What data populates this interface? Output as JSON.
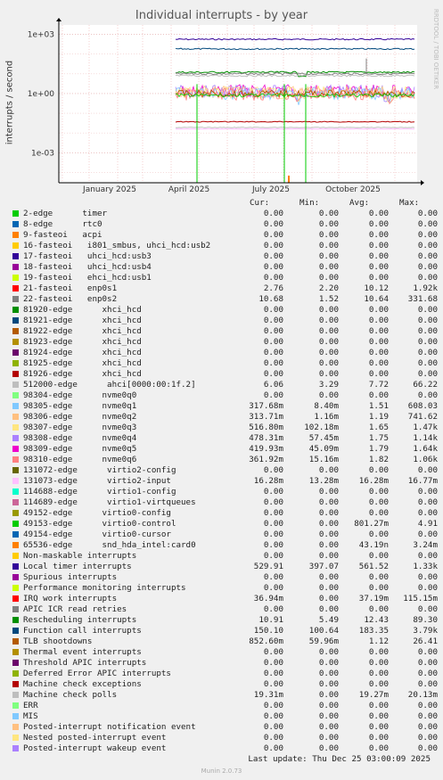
{
  "title": "Individual interrupts - by year",
  "watermark": "RRDTOOL / TOBI OETIKER",
  "chart_data": {
    "type": "line",
    "title": "Individual interrupts - by year",
    "ylabel": "interrupts / second",
    "yscale": "log",
    "ylim": [
      3e-05,
      3000
    ],
    "yticks": [
      {
        "label": "1e+03",
        "value": 1000
      },
      {
        "label": "1e+00",
        "value": 1
      },
      {
        "label": "1e-03",
        "value": 0.001
      }
    ],
    "xticks": [
      "January 2025",
      "April 2025",
      "July 2025",
      "October 2025"
    ],
    "series_summary": [
      {
        "name": "Local timer interrupts",
        "avg": 561.52
      },
      {
        "name": "Function call interrupts",
        "avg": 183.35
      },
      {
        "name": "21-fasteoi enp0s1",
        "avg": 10.12
      },
      {
        "name": "22-fasteoi enp0s2",
        "avg": 10.64
      },
      {
        "name": "Rescheduling interrupts",
        "avg": 12.43
      },
      {
        "name": "512000-edge ahci[0000:00:1f.2]",
        "avg": 7.72
      }
    ]
  },
  "columns": {
    "cur": "Cur:",
    "min": "Min:",
    "avg": "Avg:",
    "max": "Max:"
  },
  "rows": [
    {
      "label": "2-edge      timer",
      "color": "#00cc00",
      "cur": "0.00",
      "min": "0.00",
      "avg": "0.00",
      "max": "0.00"
    },
    {
      "label": "8-edge      rtc0",
      "color": "#0066b3",
      "cur": "0.00",
      "min": "0.00",
      "avg": "0.00",
      "max": "0.00"
    },
    {
      "label": "9-fasteoi   acpi",
      "color": "#ff8000",
      "cur": "0.00",
      "min": "0.00",
      "avg": "0.00",
      "max": "0.00"
    },
    {
      "label": "16-fasteoi   i801_smbus, uhci_hcd:usb2",
      "color": "#ffcc00",
      "cur": "0.00",
      "min": "0.00",
      "avg": "0.00",
      "max": "0.00"
    },
    {
      "label": "17-fasteoi   uhci_hcd:usb3",
      "color": "#330099",
      "cur": "0.00",
      "min": "0.00",
      "avg": "0.00",
      "max": "0.00"
    },
    {
      "label": "18-fasteoi   uhci_hcd:usb4",
      "color": "#990099",
      "cur": "0.00",
      "min": "0.00",
      "avg": "0.00",
      "max": "0.00"
    },
    {
      "label": "19-fasteoi   ehci_hcd:usb1",
      "color": "#ccff00",
      "cur": "0.00",
      "min": "0.00",
      "avg": "0.00",
      "max": "0.00"
    },
    {
      "label": "21-fasteoi   enp0s1",
      "color": "#ff0000",
      "cur": "2.76",
      "min": "2.20",
      "avg": "10.12",
      "max": "1.92k"
    },
    {
      "label": "22-fasteoi   enp0s2",
      "color": "#808080",
      "cur": "10.68",
      "min": "1.52",
      "avg": "10.64",
      "max": "331.68"
    },
    {
      "label": "81920-edge      xhci_hcd",
      "color": "#008f00",
      "cur": "0.00",
      "min": "0.00",
      "avg": "0.00",
      "max": "0.00"
    },
    {
      "label": "81921-edge      xhci_hcd",
      "color": "#00487d",
      "cur": "0.00",
      "min": "0.00",
      "avg": "0.00",
      "max": "0.00"
    },
    {
      "label": "81922-edge      xhci_hcd",
      "color": "#b35a00",
      "cur": "0.00",
      "min": "0.00",
      "avg": "0.00",
      "max": "0.00"
    },
    {
      "label": "81923-edge      xhci_hcd",
      "color": "#b38f00",
      "cur": "0.00",
      "min": "0.00",
      "avg": "0.00",
      "max": "0.00"
    },
    {
      "label": "81924-edge      xhci_hcd",
      "color": "#6b006b",
      "cur": "0.00",
      "min": "0.00",
      "avg": "0.00",
      "max": "0.00"
    },
    {
      "label": "81925-edge      xhci_hcd",
      "color": "#8fb300",
      "cur": "0.00",
      "min": "0.00",
      "avg": "0.00",
      "max": "0.00"
    },
    {
      "label": "81926-edge      xhci_hcd",
      "color": "#b30000",
      "cur": "0.00",
      "min": "0.00",
      "avg": "0.00",
      "max": "0.00"
    },
    {
      "label": "512000-edge      ahci[0000:00:1f.2]",
      "color": "#bebebe",
      "cur": "6.06",
      "min": "3.29",
      "avg": "7.72",
      "max": "66.22"
    },
    {
      "label": "98304-edge      nvme0q0",
      "color": "#80ff80",
      "cur": "0.00",
      "min": "0.00",
      "avg": "0.00",
      "max": "0.00"
    },
    {
      "label": "98305-edge      nvme0q1",
      "color": "#80c9ff",
      "cur": "317.68m",
      "min": "8.40m",
      "avg": "1.51",
      "max": "608.03"
    },
    {
      "label": "98306-edge      nvme0q2",
      "color": "#ffc080",
      "cur": "313.71m",
      "min": "1.16m",
      "avg": "1.19",
      "max": "741.62"
    },
    {
      "label": "98307-edge      nvme0q3",
      "color": "#ffe680",
      "cur": "516.80m",
      "min": "102.18m",
      "avg": "1.65",
      "max": "1.47k"
    },
    {
      "label": "98308-edge      nvme0q4",
      "color": "#aa80ff",
      "cur": "478.31m",
      "min": "57.45m",
      "avg": "1.75",
      "max": "1.14k"
    },
    {
      "label": "98309-edge      nvme0q5",
      "color": "#ee00cc",
      "cur": "419.93m",
      "min": "45.09m",
      "avg": "1.79",
      "max": "1.64k"
    },
    {
      "label": "98310-edge      nvme0q6",
      "color": "#ff8080",
      "cur": "361.92m",
      "min": "15.16m",
      "avg": "1.82",
      "max": "1.06k"
    },
    {
      "label": "131072-edge      virtio2-config",
      "color": "#666600",
      "cur": "0.00",
      "min": "0.00",
      "avg": "0.00",
      "max": "0.00"
    },
    {
      "label": "131073-edge      virtio2-input",
      "color": "#ffbfff",
      "cur": "16.28m",
      "min": "13.28m",
      "avg": "16.28m",
      "max": "16.77m"
    },
    {
      "label": "114688-edge      virtio1-config",
      "color": "#00ffcc",
      "cur": "0.00",
      "min": "0.00",
      "avg": "0.00",
      "max": "0.00"
    },
    {
      "label": "114689-edge      virtio1-virtqueues",
      "color": "#cc6699",
      "cur": "0.00",
      "min": "0.00",
      "avg": "0.00",
      "max": "0.00"
    },
    {
      "label": "49152-edge      virtio0-config",
      "color": "#999900",
      "cur": "0.00",
      "min": "0.00",
      "avg": "0.00",
      "max": "0.00"
    },
    {
      "label": "49153-edge      virtio0-control",
      "color": "#00cc00",
      "cur": "0.00",
      "min": "0.00",
      "avg": "801.27m",
      "max": "4.91"
    },
    {
      "label": "49154-edge      virtio0-cursor",
      "color": "#0066b3",
      "cur": "0.00",
      "min": "0.00",
      "avg": "0.00",
      "max": "0.00"
    },
    {
      "label": "65536-edge      snd_hda_intel:card0",
      "color": "#ff8000",
      "cur": "0.00",
      "min": "0.00",
      "avg": "43.19n",
      "max": "3.24m"
    },
    {
      "label": "Non-maskable interrupts",
      "color": "#ffcc00",
      "cur": "0.00",
      "min": "0.00",
      "avg": "0.00",
      "max": "0.00"
    },
    {
      "label": "Local timer interrupts",
      "color": "#330099",
      "cur": "529.91",
      "min": "397.07",
      "avg": "561.52",
      "max": "1.33k"
    },
    {
      "label": "Spurious interrupts",
      "color": "#990099",
      "cur": "0.00",
      "min": "0.00",
      "avg": "0.00",
      "max": "0.00"
    },
    {
      "label": "Performance monitoring interrupts",
      "color": "#ccff00",
      "cur": "0.00",
      "min": "0.00",
      "avg": "0.00",
      "max": "0.00"
    },
    {
      "label": "IRQ work interrupts",
      "color": "#ff0000",
      "cur": "36.94m",
      "min": "0.00",
      "avg": "37.19m",
      "max": "115.15m"
    },
    {
      "label": "APIC ICR read retries",
      "color": "#808080",
      "cur": "0.00",
      "min": "0.00",
      "avg": "0.00",
      "max": "0.00"
    },
    {
      "label": "Rescheduling interrupts",
      "color": "#008f00",
      "cur": "10.91",
      "min": "5.49",
      "avg": "12.43",
      "max": "89.30"
    },
    {
      "label": "Function call interrupts",
      "color": "#00487d",
      "cur": "150.10",
      "min": "100.64",
      "avg": "183.35",
      "max": "3.79k"
    },
    {
      "label": "TLB shootdowns",
      "color": "#b35a00",
      "cur": "852.60m",
      "min": "59.96m",
      "avg": "1.12",
      "max": "26.41"
    },
    {
      "label": "Thermal event interrupts",
      "color": "#b38f00",
      "cur": "0.00",
      "min": "0.00",
      "avg": "0.00",
      "max": "0.00"
    },
    {
      "label": "Threshold APIC interrupts",
      "color": "#6b006b",
      "cur": "0.00",
      "min": "0.00",
      "avg": "0.00",
      "max": "0.00"
    },
    {
      "label": "Deferred Error APIC interrupts",
      "color": "#8fb300",
      "cur": "0.00",
      "min": "0.00",
      "avg": "0.00",
      "max": "0.00"
    },
    {
      "label": "Machine check exceptions",
      "color": "#b30000",
      "cur": "0.00",
      "min": "0.00",
      "avg": "0.00",
      "max": "0.00"
    },
    {
      "label": "Machine check polls",
      "color": "#bebebe",
      "cur": "19.31m",
      "min": "0.00",
      "avg": "19.27m",
      "max": "20.13m"
    },
    {
      "label": "ERR",
      "color": "#80ff80",
      "cur": "0.00",
      "min": "0.00",
      "avg": "0.00",
      "max": "0.00"
    },
    {
      "label": "MIS",
      "color": "#80c9ff",
      "cur": "0.00",
      "min": "0.00",
      "avg": "0.00",
      "max": "0.00"
    },
    {
      "label": "Posted-interrupt notification event",
      "color": "#ffc080",
      "cur": "0.00",
      "min": "0.00",
      "avg": "0.00",
      "max": "0.00"
    },
    {
      "label": "Nested posted-interrupt event",
      "color": "#ffe680",
      "cur": "0.00",
      "min": "0.00",
      "avg": "0.00",
      "max": "0.00"
    },
    {
      "label": "Posted-interrupt wakeup event",
      "color": "#aa80ff",
      "cur": "0.00",
      "min": "0.00",
      "avg": "0.00",
      "max": "0.00"
    }
  ],
  "last_update": "Last update: Thu Dec 25 03:00:09 2025",
  "footer": "Munin 2.0.73"
}
